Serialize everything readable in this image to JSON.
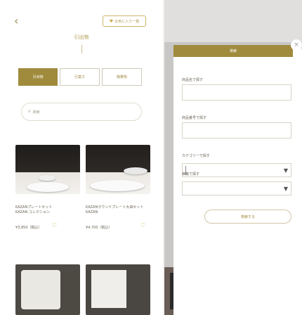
{
  "left": {
    "back_icon": "chevron-left-icon",
    "favorites_button": "お気に入り一覧",
    "page_title": "引出物",
    "tabs": [
      {
        "label": "引出物",
        "active": true
      },
      {
        "label": "引菓子",
        "active": false
      },
      {
        "label": "機費物",
        "active": false
      }
    ],
    "search_placeholder": "検索",
    "products": [
      {
        "name": "KAZANプレートセット",
        "subname": "KAZAN コレクション",
        "price": "¥3,850（税込）"
      },
      {
        "name": "KAZANラウンドプレート大皿セット",
        "subname": "KAZAN",
        "price": "¥4,700（税込）"
      }
    ]
  },
  "panel": {
    "header": "検索",
    "fields": [
      {
        "label": "商品名で探す",
        "type": "text",
        "value": ""
      },
      {
        "label": "商品番号で探す",
        "type": "text",
        "value": ""
      },
      {
        "label": "カテゴリーで探す",
        "type": "select",
        "value": ""
      },
      {
        "label": "価格で探す",
        "type": "select",
        "value": ""
      }
    ],
    "search_button": "検索する"
  },
  "colors": {
    "accent": "#a08b3d",
    "gold": "#c9a944"
  }
}
